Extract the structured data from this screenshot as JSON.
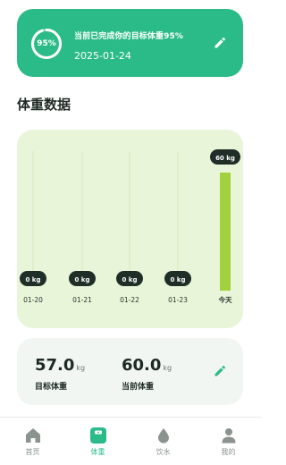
{
  "goal": {
    "progress_label": "95%",
    "progress_fraction": 0.95,
    "message": "当前已完成你的目标体重95%",
    "date": "2025-01-24",
    "edit_icon": "pencil-icon"
  },
  "section_title": "体重数据",
  "chart_data": {
    "type": "bar",
    "categories": [
      "01-20",
      "01-21",
      "01-22",
      "01-23",
      "今天"
    ],
    "values": [
      0,
      0,
      0,
      0,
      60
    ],
    "value_labels": [
      "0 kg",
      "0 kg",
      "0 kg",
      "0 kg",
      "60 kg"
    ],
    "ylim": [
      0,
      60
    ],
    "title": "",
    "xlabel": "",
    "ylabel": "",
    "colors": {
      "bar": "#9fd23c",
      "track": "#dbe9c5",
      "bubble": "#1f2f28",
      "bubble_text": "#ffffff"
    }
  },
  "stats": {
    "target": {
      "value": "57.0",
      "unit": "kg",
      "label": "目标体重"
    },
    "current": {
      "value": "60.0",
      "unit": "kg",
      "label": "当前体重"
    },
    "edit_icon": "pencil-icon"
  },
  "nav": {
    "items": [
      {
        "label": "首页",
        "icon": "home-icon",
        "active": false
      },
      {
        "label": "体重",
        "icon": "scale-icon",
        "active": true
      },
      {
        "label": "饮水",
        "icon": "water-drop-icon",
        "active": false
      },
      {
        "label": "我的",
        "icon": "person-icon",
        "active": false
      }
    ]
  },
  "colors": {
    "accent": "#2bbb88",
    "inactive": "#8a938e"
  }
}
